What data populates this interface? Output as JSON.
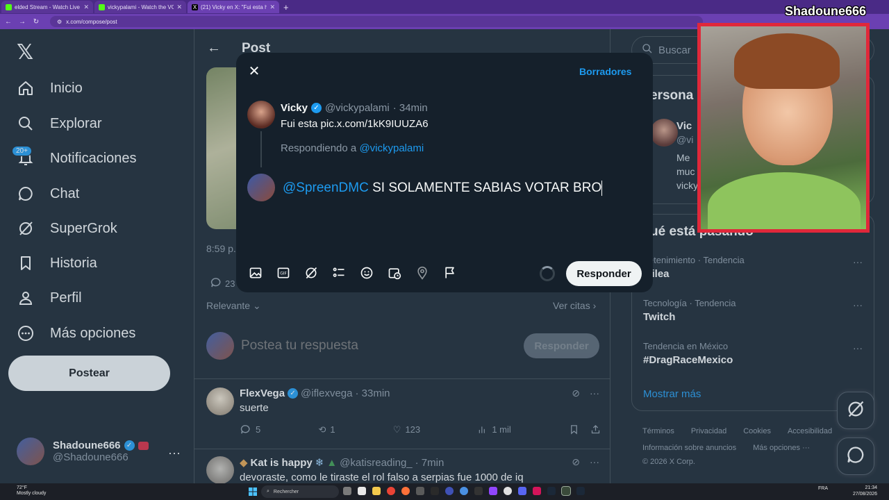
{
  "browser": {
    "tabs": [
      {
        "title": "elded Stream - Watch Live on",
        "color": "#53fc18",
        "active": false
      },
      {
        "title": "vickypalami - Watch the VOD",
        "color": "#53fc18",
        "active": false
      },
      {
        "title": "(21) Vicky en X: \"Fui esta https",
        "color": "#000000",
        "active": true
      }
    ],
    "new_tab": "+",
    "url": "x.com/compose/post"
  },
  "sidebar": {
    "items": [
      {
        "label": "Inicio",
        "icon": "home-icon"
      },
      {
        "label": "Explorar",
        "icon": "search-icon"
      },
      {
        "label": "Notificaciones",
        "icon": "bell-icon"
      },
      {
        "label": "Chat",
        "icon": "chat-icon"
      },
      {
        "label": "SuperGrok",
        "icon": "grok-icon"
      },
      {
        "label": "Historia",
        "icon": "bookmark-icon"
      },
      {
        "label": "Perfil",
        "icon": "person-icon"
      },
      {
        "label": "Más opciones",
        "icon": "more-circle-icon"
      }
    ],
    "notif_badge": "20+",
    "post_button": "Postear",
    "account": {
      "name": "Shadoune666",
      "handle": "@Shadoune666",
      "more": "···"
    }
  },
  "center": {
    "header_title": "Post",
    "time_fragment": "8:59 p.",
    "reply_count_fragment": "23",
    "relevance": "Relevante",
    "see_quotes": "Ver citas",
    "composer_placeholder": "Postea tu respuesta",
    "composer_button": "Responder",
    "tweets": [
      {
        "name": "FlexVega",
        "handle": "@iflexvega",
        "time": "· 33min",
        "text": "suerte",
        "replies": "5",
        "retweets": "1",
        "likes": "123",
        "views": "1 mil"
      },
      {
        "name": "Kat is happy",
        "handle": "@katisreading_",
        "time": "· 7min",
        "text": "devoraste, como le tiraste el rol falso a serpias fue 1000 de iq"
      }
    ]
  },
  "right": {
    "search_placeholder": "Buscar",
    "people_title": "ersona",
    "person_name": "Vic",
    "person_handle": "@vi",
    "person_bio": [
      "Me",
      "muc",
      "vicky"
    ],
    "trends_title": "ué está pasando",
    "trends": [
      {
        "category": "tretenimiento · Tendencia",
        "name": "alilea"
      },
      {
        "category": "Tecnología · Tendencia",
        "name": "Twitch"
      },
      {
        "category": "Tendencia en México",
        "name": "#DragRaceMexico"
      }
    ],
    "show_more": "Mostrar más",
    "footer_row1": [
      "Términos",
      "Privacidad",
      "Cookies",
      "Accesibilidad"
    ],
    "footer_row2": [
      "Información sobre anuncios",
      "Más opciones ···"
    ],
    "copyright": "© 2026 X Corp."
  },
  "modal": {
    "drafts": "Borradores",
    "original": {
      "name": "Vicky",
      "handle": "@vickypalami",
      "time": "· 34min",
      "text": "Fui esta pic.x.com/1kK9IUUZA6"
    },
    "replying_prefix": "Respondiendo a",
    "replying_to": "@vickypalami",
    "reply_mention": "@SpreenDMC",
    "reply_text": " SI SOLAMENTE SABIAS VOTAR BRO",
    "reply_button": "Responder"
  },
  "stream": {
    "streamer_name": "Shadoune666"
  },
  "taskbar": {
    "weather_temp": "72°F",
    "weather_desc": "Mostly cloudy",
    "search": "Rechercher",
    "lang": "FRA",
    "time": "21:34",
    "date": "27/08/2026"
  },
  "colors": {
    "background": "#15202b",
    "accent": "#1d9bf0",
    "cam_border": "#e0283a"
  }
}
